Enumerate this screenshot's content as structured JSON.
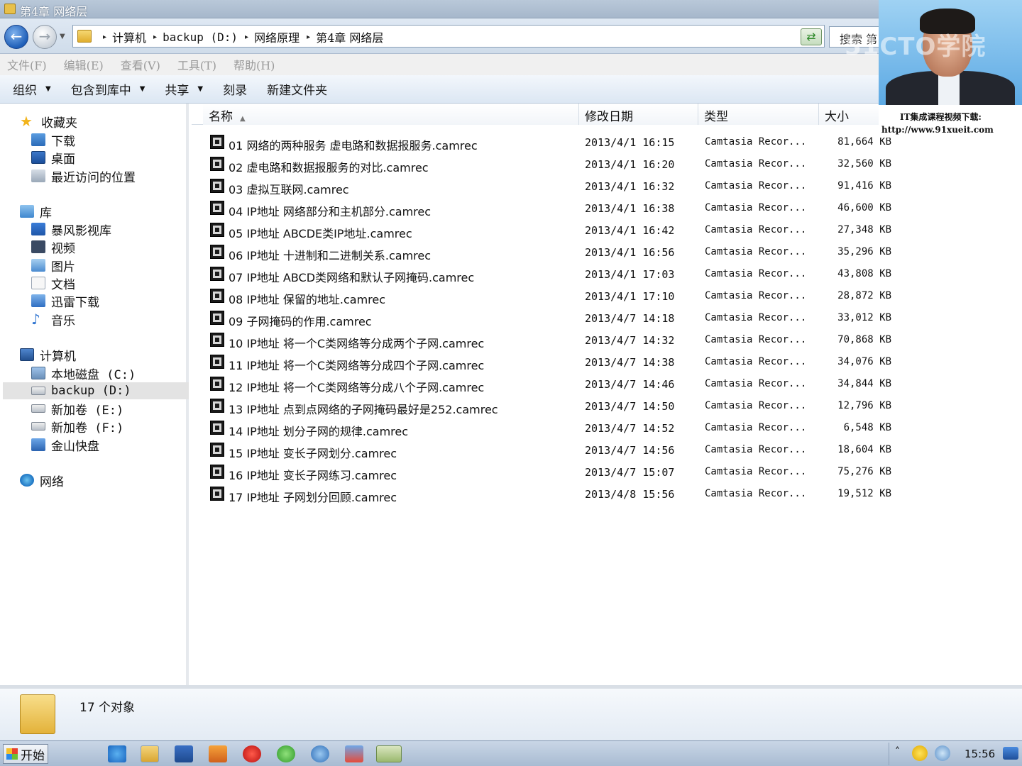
{
  "window": {
    "title": "第4章 网络层"
  },
  "nav": {
    "back_icon": "back-arrow-icon",
    "forward_icon": "forward-arrow-icon",
    "breadcrumb": [
      "计算机",
      "backup (D:)",
      "网络原理",
      "第4章 网络层"
    ],
    "search_placeholder": "搜索 第"
  },
  "menu": [
    "文件(F)",
    "编辑(E)",
    "查看(V)",
    "工具(T)",
    "帮助(H)"
  ],
  "commands": [
    {
      "label": "组织",
      "dropdown": true
    },
    {
      "label": "包含到库中",
      "dropdown": true
    },
    {
      "label": "共享",
      "dropdown": true
    },
    {
      "label": "刻录",
      "dropdown": false
    },
    {
      "label": "新建文件夹",
      "dropdown": false
    }
  ],
  "sidebar": {
    "favorites": {
      "label": "收藏夹",
      "items": [
        "下载",
        "桌面",
        "最近访问的位置"
      ]
    },
    "libraries": {
      "label": "库",
      "items": [
        "暴风影视库",
        "视频",
        "图片",
        "文档",
        "迅雷下载",
        "音乐"
      ]
    },
    "computer": {
      "label": "计算机",
      "items": [
        "本地磁盘 (C:)",
        "backup (D:)",
        "新加卷 (E:)",
        "新加卷 (F:)",
        "金山快盘"
      ],
      "selected": "backup (D:)"
    },
    "network": {
      "label": "网络"
    }
  },
  "columns": {
    "name": "名称",
    "date": "修改日期",
    "type": "类型",
    "size": "大小"
  },
  "files": [
    {
      "name": "01 网络的两种服务 虚电路和数据报服务.camrec",
      "date": "2013/4/1 16:15",
      "type": "Camtasia Recor...",
      "size": "81,664 KB"
    },
    {
      "name": "02 虚电路和数据报服务的对比.camrec",
      "date": "2013/4/1 16:20",
      "type": "Camtasia Recor...",
      "size": "32,560 KB"
    },
    {
      "name": "03 虚拟互联网.camrec",
      "date": "2013/4/1 16:32",
      "type": "Camtasia Recor...",
      "size": "91,416 KB"
    },
    {
      "name": "04 IP地址 网络部分和主机部分.camrec",
      "date": "2013/4/1 16:38",
      "type": "Camtasia Recor...",
      "size": "46,600 KB"
    },
    {
      "name": "05 IP地址 ABCDE类IP地址.camrec",
      "date": "2013/4/1 16:42",
      "type": "Camtasia Recor...",
      "size": "27,348 KB"
    },
    {
      "name": "06 IP地址 十进制和二进制关系.camrec",
      "date": "2013/4/1 16:56",
      "type": "Camtasia Recor...",
      "size": "35,296 KB"
    },
    {
      "name": "07 IP地址 ABCD类网络和默认子网掩码.camrec",
      "date": "2013/4/1 17:03",
      "type": "Camtasia Recor...",
      "size": "43,808 KB"
    },
    {
      "name": "08 IP地址 保留的地址.camrec",
      "date": "2013/4/1 17:10",
      "type": "Camtasia Recor...",
      "size": "28,872 KB"
    },
    {
      "name": "09 子网掩码的作用.camrec",
      "date": "2013/4/7 14:18",
      "type": "Camtasia Recor...",
      "size": "33,012 KB"
    },
    {
      "name": "10 IP地址 将一个C类网络等分成两个子网.camrec",
      "date": "2013/4/7 14:32",
      "type": "Camtasia Recor...",
      "size": "70,868 KB"
    },
    {
      "name": "11 IP地址 将一个C类网络等分成四个子网.camrec",
      "date": "2013/4/7 14:38",
      "type": "Camtasia Recor...",
      "size": "34,076 KB"
    },
    {
      "name": "12 IP地址 将一个C类网络等分成八个子网.camrec",
      "date": "2013/4/7 14:46",
      "type": "Camtasia Recor...",
      "size": "34,844 KB"
    },
    {
      "name": "13 IP地址 点到点网络的子网掩码最好是252.camrec",
      "date": "2013/4/7 14:50",
      "type": "Camtasia Recor...",
      "size": "12,796 KB"
    },
    {
      "name": "14 IP地址 划分子网的规律.camrec",
      "date": "2013/4/7 14:52",
      "type": "Camtasia Recor...",
      "size": "6,548 KB"
    },
    {
      "name": "15 IP地址 变长子网划分.camrec",
      "date": "2013/4/7 14:56",
      "type": "Camtasia Recor...",
      "size": "18,604 KB"
    },
    {
      "name": "16 IP地址 变长子网练习.camrec",
      "date": "2013/4/7 15:07",
      "type": "Camtasia Recor...",
      "size": "75,276 KB"
    },
    {
      "name": "17 IP地址 子网划分回顾.camrec",
      "date": "2013/4/8 15:56",
      "type": "Camtasia Recor...",
      "size": "19,512 KB"
    }
  ],
  "status": {
    "count_text": "17 个对象"
  },
  "taskbar": {
    "start_label": "开始",
    "clock": "15:56",
    "icons": [
      "ie-icon",
      "explorer-icon",
      "media-icon",
      "gift-icon",
      "player-icon",
      "browser-icon",
      "network-icon",
      "dispatch-icon",
      "camtasia-icon"
    ]
  },
  "overlay": {
    "watermark": "51CTO学院",
    "promo_line1": "IT集成课程视频下载:",
    "promo_line2": "http://www.91xueit.com"
  }
}
